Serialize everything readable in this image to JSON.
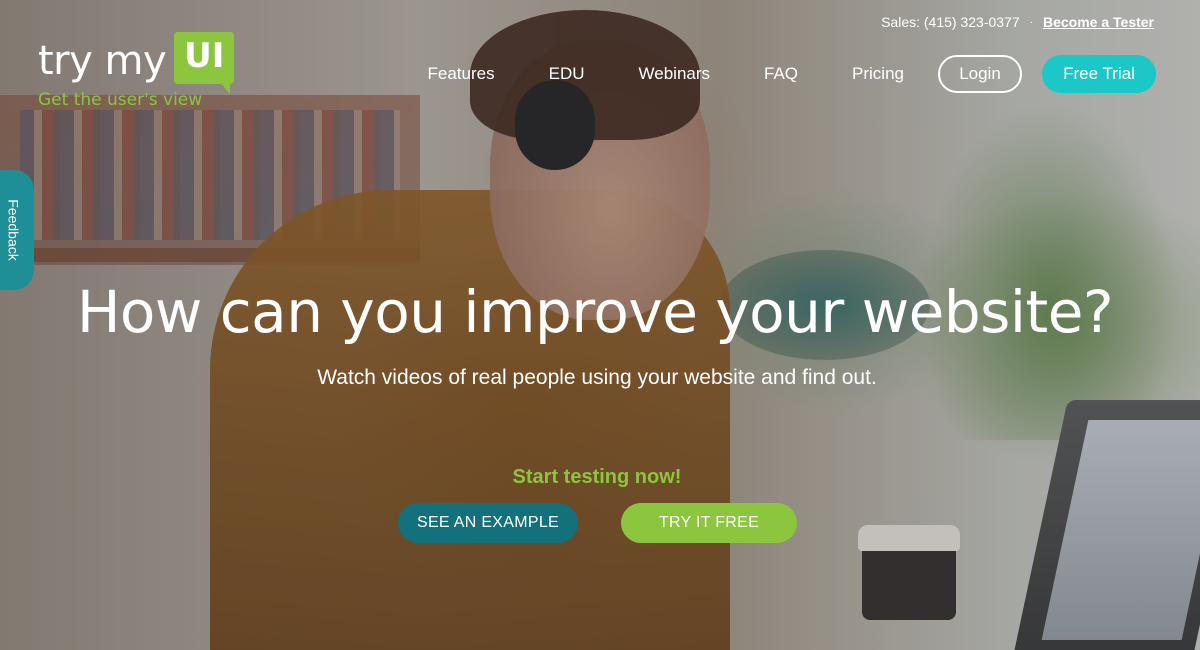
{
  "logo": {
    "text": "try my",
    "badge": "UI",
    "tagline": "Get the user's view"
  },
  "topbar": {
    "sales": "Sales: (415) 323-0377",
    "separator": "·",
    "tester_link": "Become a Tester"
  },
  "nav": {
    "items": [
      {
        "label": "Features"
      },
      {
        "label": "EDU"
      },
      {
        "label": "Webinars"
      },
      {
        "label": "FAQ"
      },
      {
        "label": "Pricing"
      }
    ],
    "login": "Login",
    "free_trial": "Free Trial"
  },
  "feedback_tab": "Feedback",
  "hero": {
    "headline": "How can you improve your website?",
    "subhead": "Watch videos of real people using your website and find out.",
    "cta_label": "Start testing now!",
    "see_example": "SEE AN EXAMPLE",
    "try_free": "TRY IT FREE"
  },
  "colors": {
    "brand_green": "#8cc63f",
    "teal": "#1cc7c7",
    "dark_teal": "#12717a"
  }
}
